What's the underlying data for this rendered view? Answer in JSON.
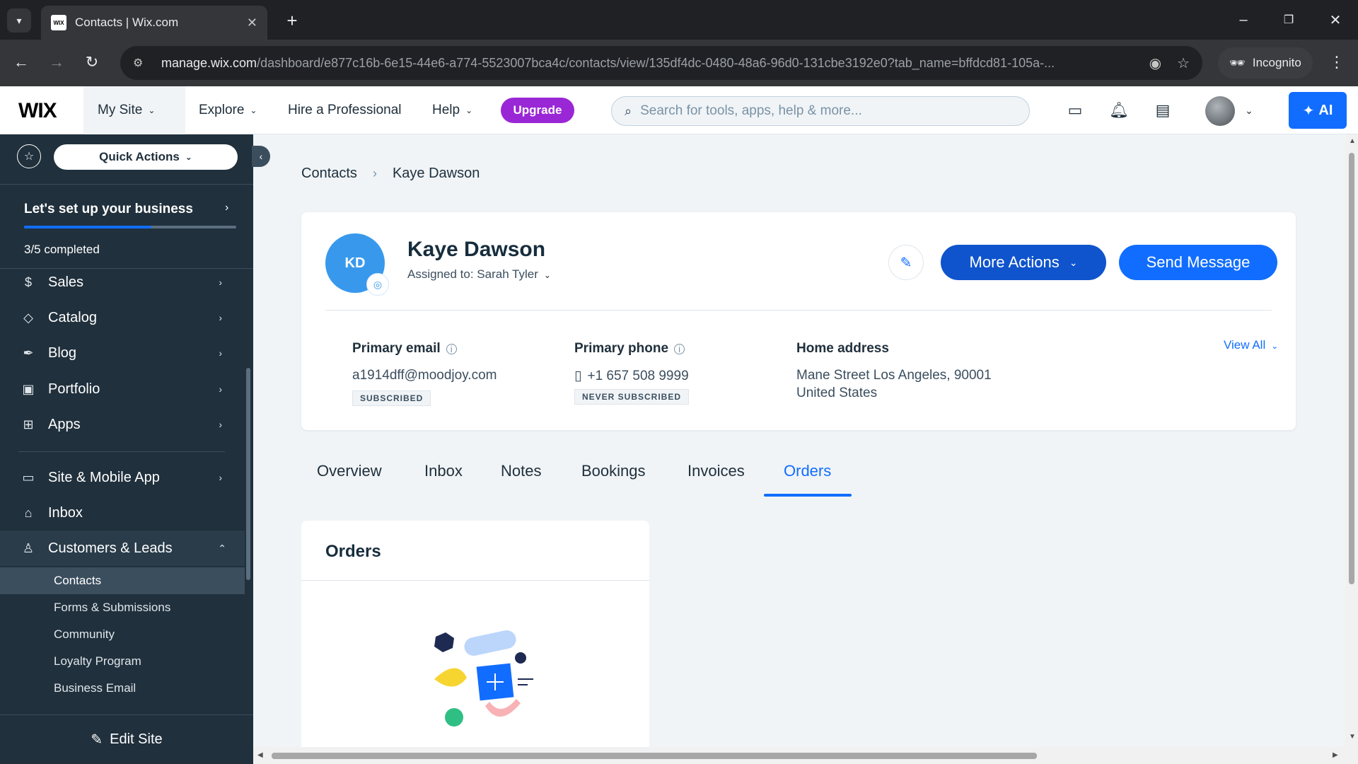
{
  "browser": {
    "tab_title": "Contacts | Wix.com",
    "favicon_text": "WIX",
    "url_host": "manage.wix.com",
    "url_path": "/dashboard/e877c16b-6e15-44e6-a774-5523007bca4c/contacts/view/135df4dc-0480-48a6-96d0-131cbe3192e0?tab_name=bffdcd81-105a-...",
    "incognito_label": "Incognito"
  },
  "topbar": {
    "logo": "WIX",
    "my_site": "My Site",
    "explore": "Explore",
    "hire": "Hire a Professional",
    "help": "Help",
    "upgrade": "Upgrade",
    "search_placeholder": "Search for tools, apps, help & more...",
    "ai_label": "AI"
  },
  "sidebar": {
    "quick_actions": "Quick Actions",
    "setup_title": "Let's set up your business",
    "setup_progress": 0.6,
    "setup_count": "3/5 completed",
    "items": [
      {
        "label": "Sales"
      },
      {
        "label": "Catalog"
      },
      {
        "label": "Blog"
      },
      {
        "label": "Portfolio"
      },
      {
        "label": "Apps"
      },
      {
        "label": "Site & Mobile App"
      },
      {
        "label": "Inbox"
      },
      {
        "label": "Customers & Leads"
      }
    ],
    "subitems": [
      {
        "label": "Contacts"
      },
      {
        "label": "Forms & Submissions"
      },
      {
        "label": "Community"
      },
      {
        "label": "Loyalty Program"
      },
      {
        "label": "Business Email"
      }
    ],
    "edit_site": "Edit Site"
  },
  "main": {
    "breadcrumb": {
      "parent": "Contacts",
      "current": "Kaye Dawson"
    },
    "contact": {
      "initials": "KD",
      "name": "Kaye Dawson",
      "assigned": "Assigned to: Sarah Tyler",
      "more_actions": "More Actions",
      "send_message": "Send Message",
      "email_label": "Primary email",
      "email": "a1914dff@moodjoy.com",
      "email_status": "SUBSCRIBED",
      "phone_label": "Primary phone",
      "phone": "+1 657 508 9999",
      "phone_status": "NEVER SUBSCRIBED",
      "address_label": "Home address",
      "address_line1": "Mane Street Los Angeles, 90001",
      "address_line2": "United States",
      "view_all": "View All"
    },
    "tabs": [
      {
        "label": "Overview"
      },
      {
        "label": "Inbox"
      },
      {
        "label": "Notes"
      },
      {
        "label": "Bookings"
      },
      {
        "label": "Invoices"
      },
      {
        "label": "Orders",
        "active": true
      }
    ],
    "orders_title": "Orders"
  },
  "colors": {
    "accent": "#116dff",
    "sidebar_bg": "#20303c",
    "upgrade": "#9a27d5",
    "more_actions": "#0f54cc"
  }
}
